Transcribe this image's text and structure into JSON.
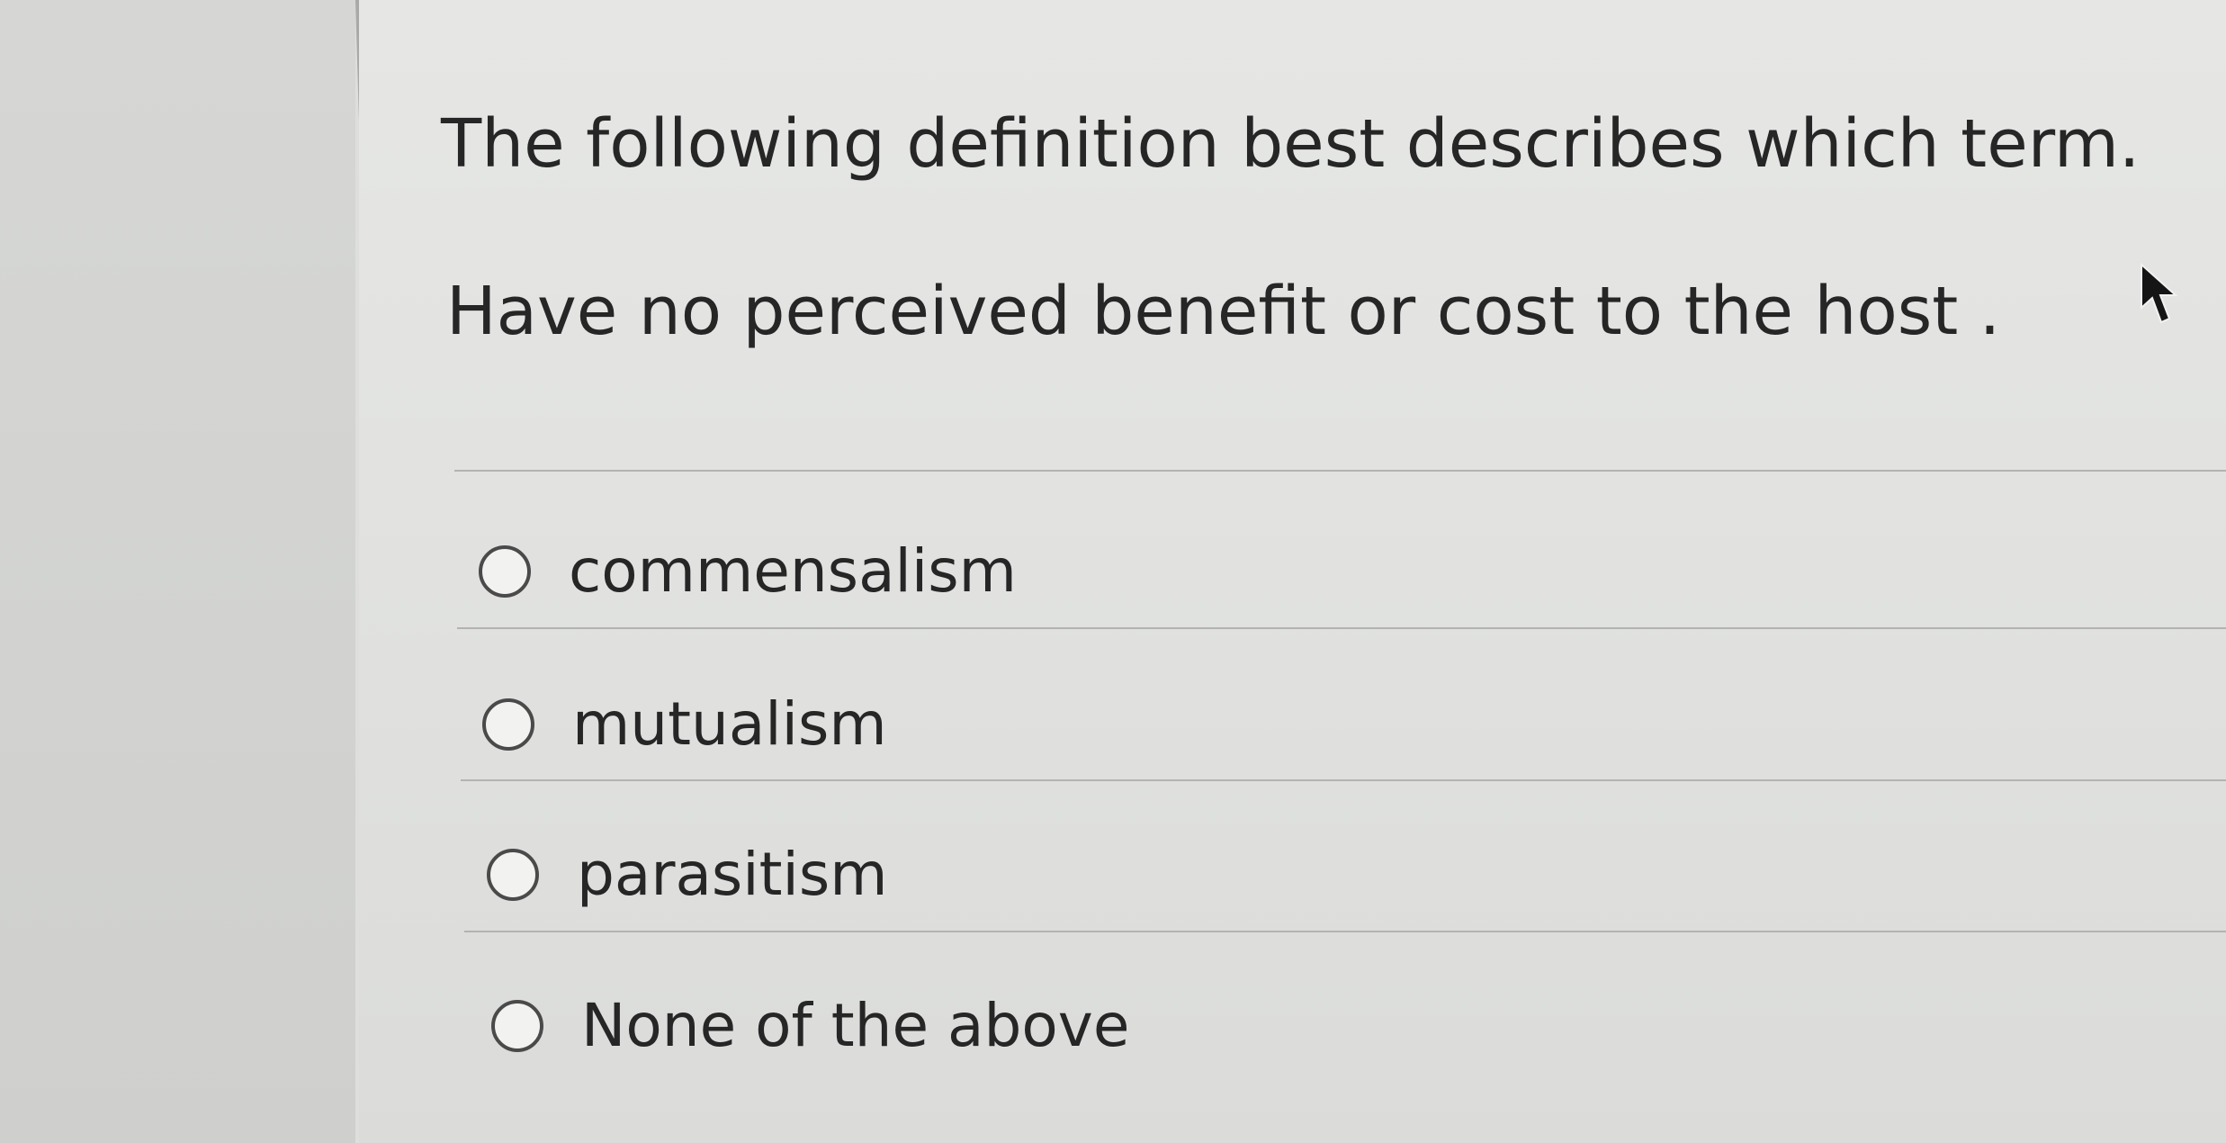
{
  "question": {
    "prompt": "The following definition best describes which term.",
    "definition": "Have no perceived benefit or cost to the host ."
  },
  "options": [
    {
      "label": "commensalism",
      "selected": false
    },
    {
      "label": "mutualism",
      "selected": false
    },
    {
      "label": "parasitism",
      "selected": false
    },
    {
      "label": "None of the above",
      "selected": false
    }
  ],
  "icons": {
    "radio": "radio-unselected-icon",
    "cursor": "mouse-pointer-icon"
  },
  "colors": {
    "text": "#262626",
    "radio_border": "#4a4a4a",
    "divider": "#b3b4b2",
    "background": "#e1e2e0"
  }
}
